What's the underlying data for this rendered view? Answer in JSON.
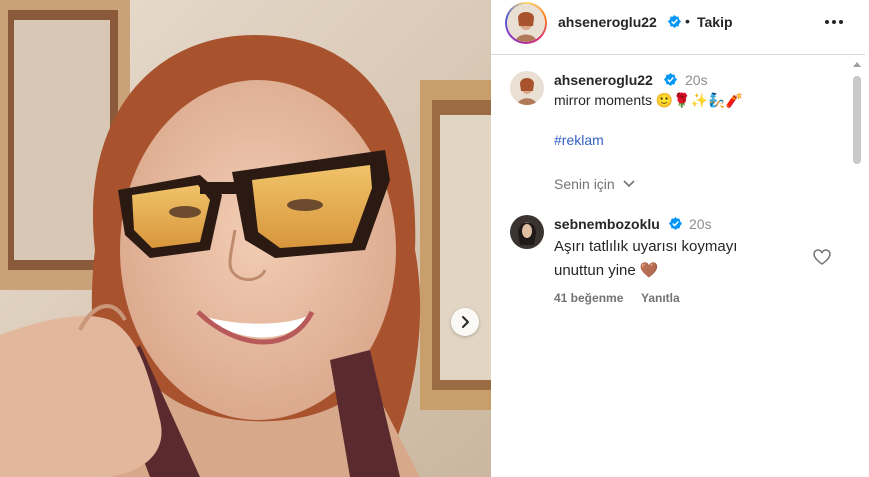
{
  "post": {
    "author": "ahseneroglu22",
    "follow_label": "Takip",
    "caption_time": "20s",
    "caption_text": "mirror moments 🙂🌹✨🧞🧨",
    "hashtag": "#reklam",
    "for_you_label": "Senin için"
  },
  "comment": {
    "author": "sebnembozoklu",
    "time": "20s",
    "line1": "Aşırı tatlılık uyarısı koymayı",
    "line2": "unuttun yine 🤎",
    "likes": "41 beğenme",
    "reply_label": "Yanıtla"
  },
  "icons": {
    "verified": "verified-badge-icon",
    "more": "more-options-icon",
    "next": "chevron-right-icon",
    "heart": "heart-icon",
    "chevron_down": "chevron-down-icon"
  },
  "colors": {
    "verified": "#0095f6",
    "hashtag": "#3560c4"
  }
}
